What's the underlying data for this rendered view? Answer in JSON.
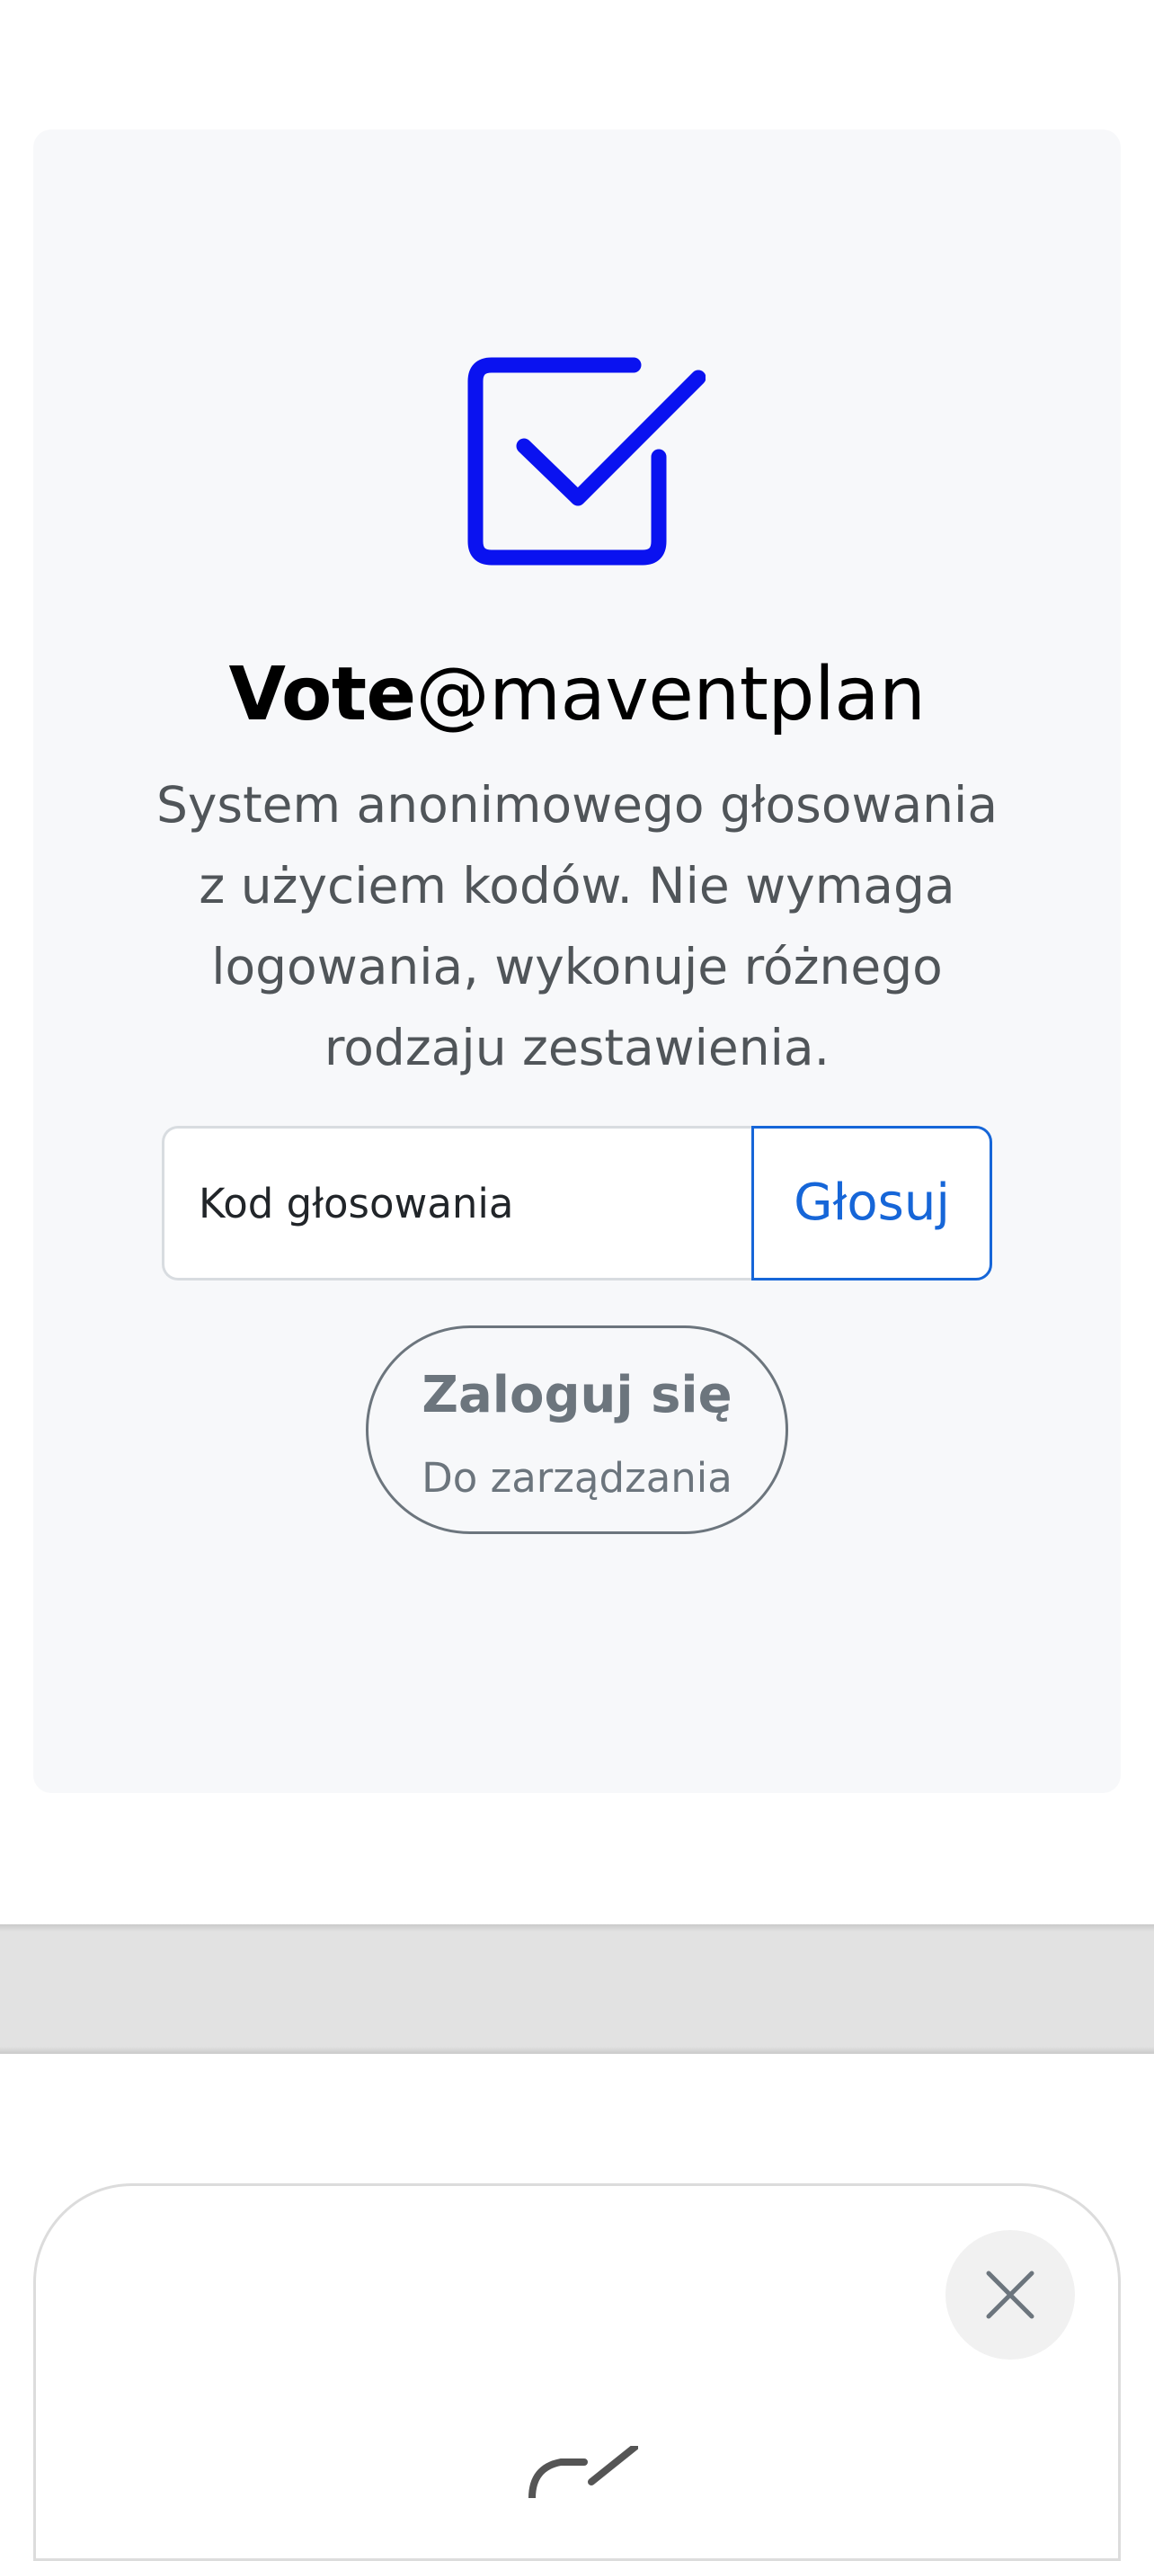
{
  "brand": {
    "title_bold": "Vote",
    "title_rest": "@maventplan",
    "icon": "checkbox-checked-icon",
    "accent_color": "#0a12f0"
  },
  "intro": {
    "description": "System anonimowego głosowania z użyciem kodów. Nie wymaga logowania, wykonuje różnego rodzaju zestawienia."
  },
  "vote_form": {
    "input_placeholder": "Kod głosowania",
    "submit_label": "Głosuj",
    "button_color": "#1666d8"
  },
  "login": {
    "title": "Zaloguj się",
    "subtitle": "Do zarządzania"
  },
  "modal": {
    "close_icon": "close-icon",
    "partial_icon": "checkbox-checked-icon"
  }
}
